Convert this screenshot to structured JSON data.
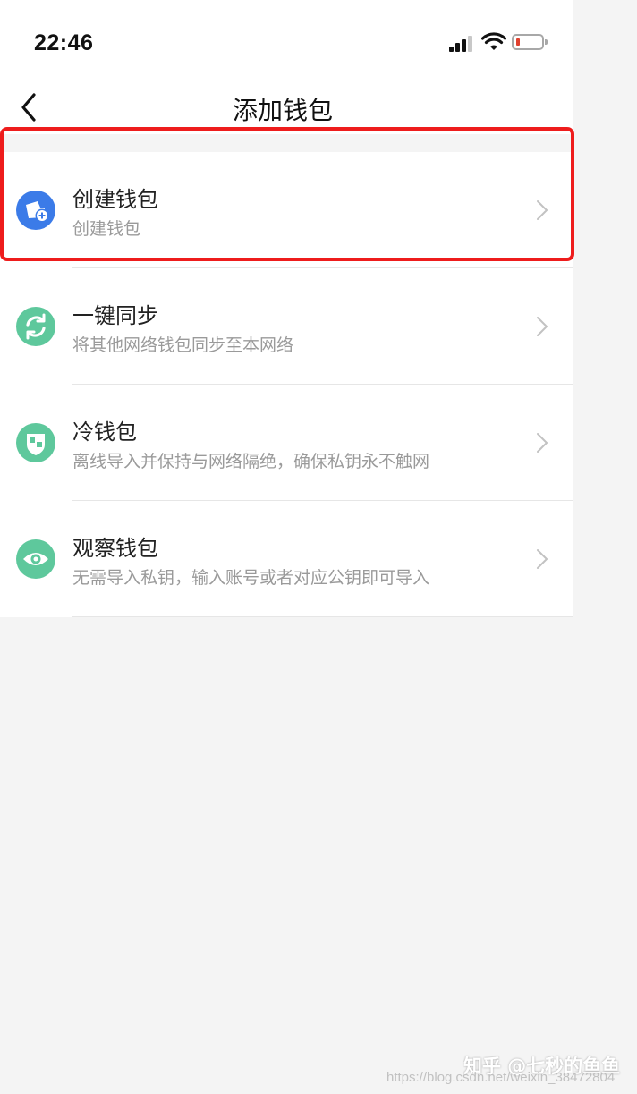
{
  "status_bar": {
    "time": "22:46",
    "battery_color": "#e0412f"
  },
  "header": {
    "title": "添加钱包",
    "back_icon": "chevron-left-icon"
  },
  "items": [
    {
      "name": "创建钱包",
      "desc": "创建钱包",
      "icon": "wallet-add-icon",
      "icon_color": "#3b7be8"
    },
    {
      "name": "一键同步",
      "desc": "将其他网络钱包同步至本网络",
      "icon": "sync-icon",
      "icon_color": "#5ec89c"
    },
    {
      "name": "冷钱包",
      "desc": "离线导入并保持与网络隔绝，确保私钥永不触网",
      "icon": "cold-wallet-shield-icon",
      "icon_color": "#5ec89c"
    },
    {
      "name": "观察钱包",
      "desc": "无需导入私钥，输入账号或者对应公钥即可导入",
      "icon": "eye-icon",
      "icon_color": "#5ec89c"
    }
  ],
  "annotation": {
    "highlight_color": "#ee1c1c"
  },
  "watermark": {
    "text": "知乎 @七秒的鱼鱼",
    "url_text": "https://blog.csdn.net/weixin_38472804"
  }
}
